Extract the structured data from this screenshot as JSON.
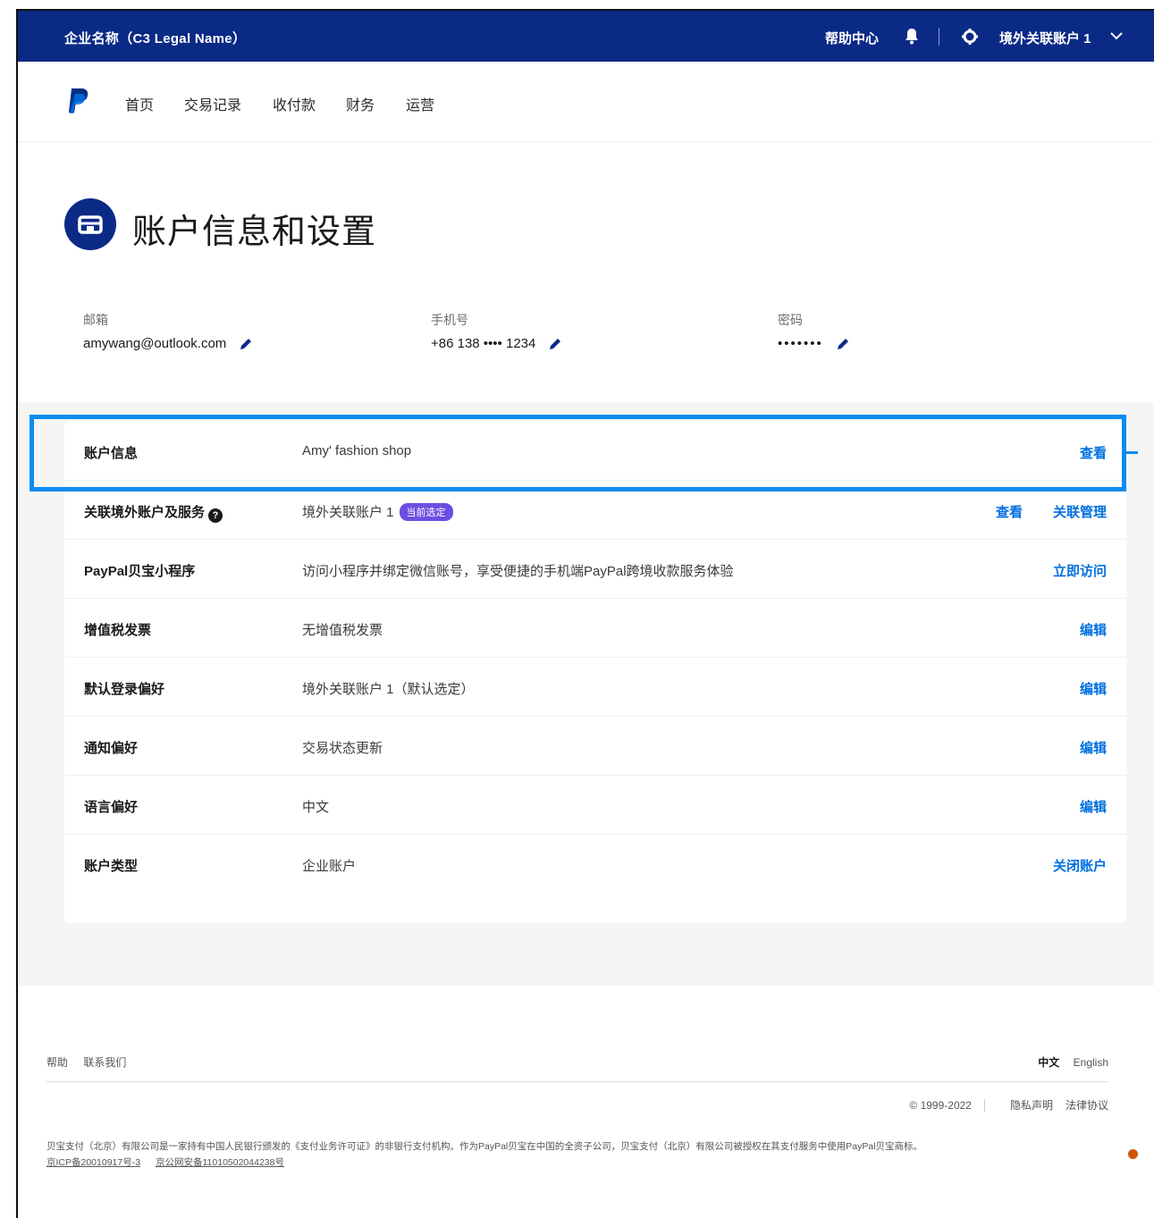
{
  "topbar": {
    "company": "企业名称（C3 Legal Name）",
    "help": "帮助中心",
    "account": "境外关联账户 1"
  },
  "nav": {
    "items": [
      "首页",
      "交易记录",
      "收付款",
      "财务",
      "运营"
    ]
  },
  "page": {
    "title": "账户信息和设置"
  },
  "fields": [
    {
      "label": "邮箱",
      "value": "amywang@outlook.com"
    },
    {
      "label": "手机号",
      "value": "+86 138 •••• 1234"
    },
    {
      "label": "密码",
      "value": "•••••••"
    }
  ],
  "rows": [
    {
      "label": "账户信息",
      "value": "Amy' fashion shop",
      "actions": [
        "查看"
      ]
    },
    {
      "label": "关联境外账户及服务",
      "value": "境外关联账户 1",
      "badge": "当前选定",
      "actions": [
        "查看",
        "关联管理"
      ]
    },
    {
      "label": "PayPal贝宝小程序",
      "value": "访问小程序并绑定微信账号，享受便捷的手机端PayPal跨境收款服务体验",
      "actions": [
        "立即访问"
      ]
    },
    {
      "label": "增值税发票",
      "value": "无增值税发票",
      "actions": [
        "编辑"
      ]
    },
    {
      "label": "默认登录偏好",
      "value": "境外关联账户 1（默认选定）",
      "actions": [
        "编辑"
      ]
    },
    {
      "label": "通知偏好",
      "value": "交易状态更新",
      "actions": [
        "编辑"
      ]
    },
    {
      "label": "语言偏好",
      "value": "中文",
      "actions": [
        "编辑"
      ]
    },
    {
      "label": "账户类型",
      "value": "企业账户",
      "actions": [
        "关闭账户"
      ]
    }
  ],
  "footer": {
    "links": [
      "帮助",
      "联系我们"
    ],
    "lang_zh": "中文",
    "lang_en": "English",
    "copyright": "© 1999-2022",
    "privacy": "隐私声明",
    "legal": "法律协议",
    "disclaimer": "贝宝支付（北京）有限公司是一家持有中国人民银行颁发的《支付业务许可证》的非银行支付机构。作为PayPal贝宝在中国的全资子公司，贝宝支付（北京）有限公司被授权在其支付服务中使用PayPal贝宝商标。",
    "icp1": "京ICP备20010917号-3",
    "icp2": "京公网安备11010502044238号"
  },
  "colors": {
    "topbar": "#0b2a86",
    "link": "#0070e0",
    "highlight": "#0a8cf0",
    "badge": "#6b4fe0"
  },
  "icons": [
    "bell-icon",
    "gear-icon",
    "chevron-down-icon",
    "paypal-logo",
    "store-icon",
    "pencil-icon",
    "info-icon"
  ]
}
